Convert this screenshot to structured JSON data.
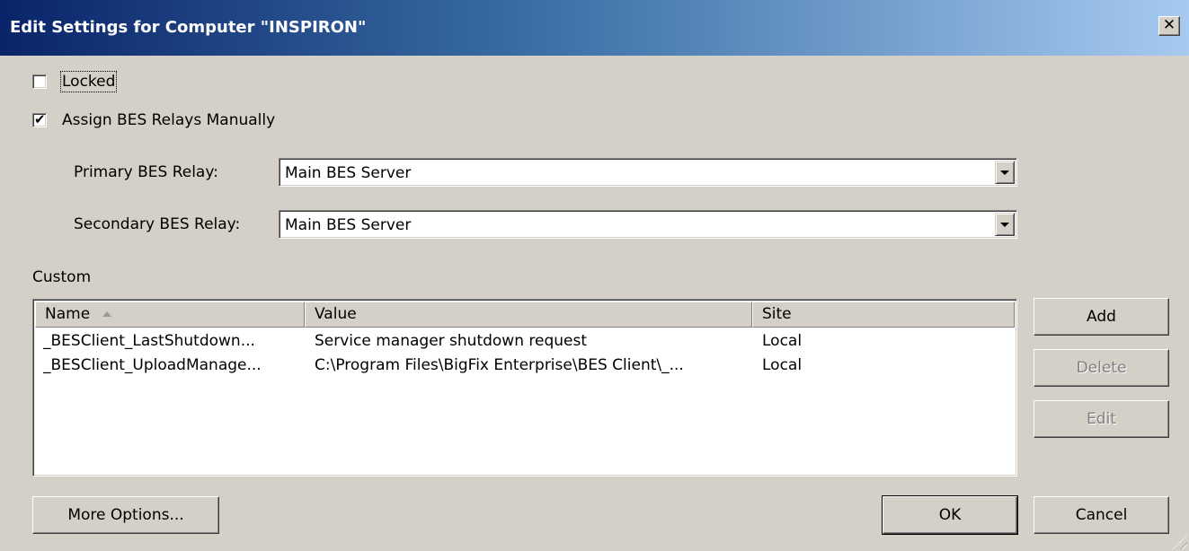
{
  "window": {
    "title": "Edit Settings for Computer \"INSPIRON\"",
    "close_glyph": "✕"
  },
  "locked": {
    "label": "Locked",
    "checked": false
  },
  "assign_relays": {
    "label": "Assign BES Relays Manually",
    "checked": true
  },
  "primary_relay": {
    "label": "Primary BES Relay:",
    "value": "Main BES Server"
  },
  "secondary_relay": {
    "label": "Secondary BES Relay:",
    "value": "Main BES Server"
  },
  "custom": {
    "label": "Custom",
    "columns": [
      "Name",
      "Value",
      "Site"
    ],
    "sorted_column": "Name",
    "rows": [
      {
        "name": "_BESClient_LastShutdown...",
        "value": "Service manager shutdown request",
        "site": "Local"
      },
      {
        "name": "_BESClient_UploadManage...",
        "value": "C:\\Program Files\\BigFix Enterprise\\BES Client\\_...",
        "site": "Local"
      }
    ]
  },
  "buttons": {
    "add": "Add",
    "delete": "Delete",
    "edit": "Edit",
    "more_options": "More Options...",
    "ok": "OK",
    "cancel": "Cancel"
  },
  "icons": {
    "checkmark": "✔",
    "dropdown": "chevron-down-icon",
    "close": "close-icon"
  }
}
